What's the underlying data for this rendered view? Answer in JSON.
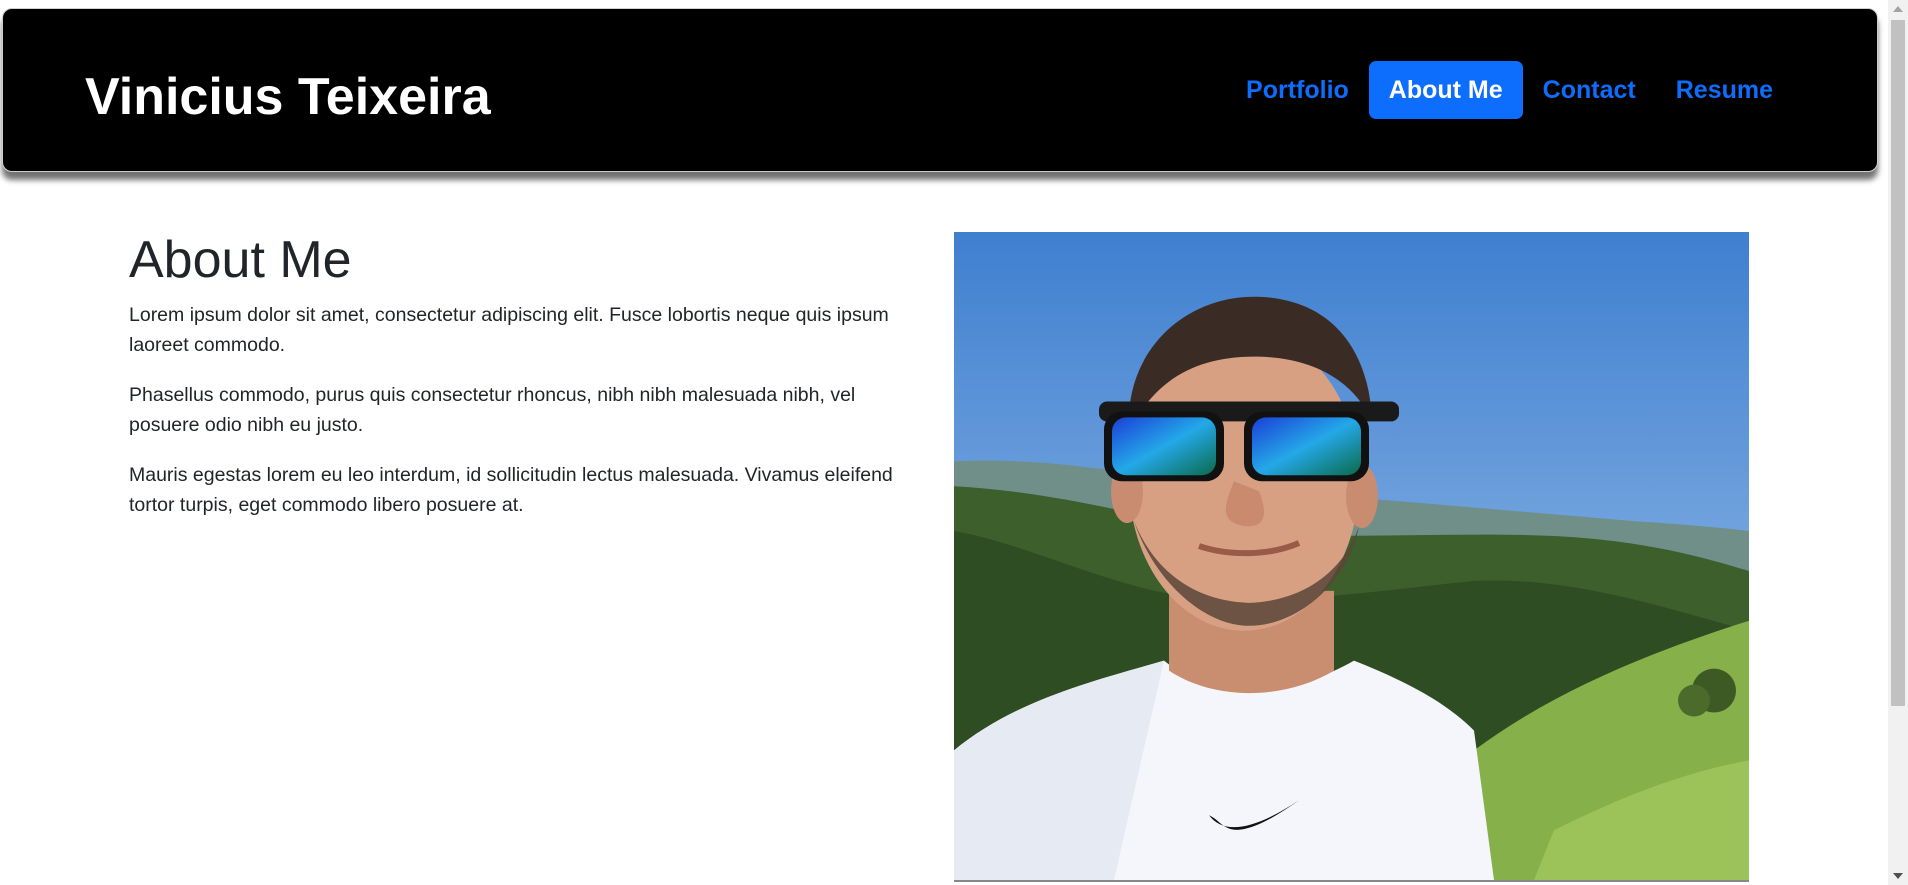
{
  "header": {
    "brand": "Vinicius Teixeira",
    "nav": [
      {
        "label": "Portfolio",
        "active": false
      },
      {
        "label": "About Me",
        "active": true
      },
      {
        "label": "Contact",
        "active": false
      },
      {
        "label": "Resume",
        "active": false
      }
    ]
  },
  "about": {
    "heading": "About Me",
    "paragraphs": [
      "Lorem ipsum dolor sit amet, consectetur adipiscing elit. Fusce lobortis neque quis ipsum laoreet commodo.",
      "Phasellus commodo, purus quis consectetur rhoncus, nibh nibh malesuada nibh, vel posuere odio nibh eu justo.",
      "Mauris egestas lorem eu leo interdum, id sollicitudin lectus malesuada. Vivamus eleifend tortor turpis, eget commodo libero posuere at."
    ]
  },
  "colors": {
    "accent": "#0d6efd",
    "header_bg": "#000000",
    "text": "#212529"
  }
}
